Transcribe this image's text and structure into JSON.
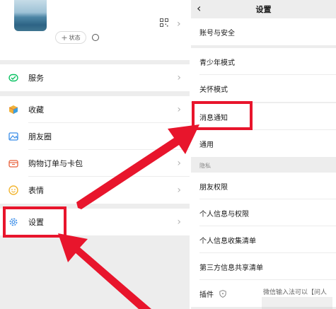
{
  "profile": {
    "status_label": "状态",
    "status_plus": "+"
  },
  "menu": {
    "items": [
      {
        "label": "服务",
        "icon": "service-icon"
      },
      {
        "label": "收藏",
        "icon": "favorites-icon"
      },
      {
        "label": "朋友圈",
        "icon": "moments-icon"
      },
      {
        "label": "购物订单与卡包",
        "icon": "cards-icon"
      },
      {
        "label": "表情",
        "icon": "emoji-icon"
      },
      {
        "label": "设置",
        "icon": "gear-icon"
      }
    ]
  },
  "settings": {
    "title": "设置",
    "back_glyph": "‹",
    "items": [
      {
        "label": "账号与安全"
      },
      {
        "label": "青少年模式"
      },
      {
        "label": "关怀模式"
      },
      {
        "label": "消息通知"
      },
      {
        "label": "通用"
      },
      {
        "label": "朋友权限"
      },
      {
        "label": "个人信息与权限"
      },
      {
        "label": "个人信息收集清单"
      },
      {
        "label": "第三方信息共享清单"
      },
      {
        "label": "插件"
      }
    ],
    "privacy_section": "隐私",
    "overlay_text": "微信输入法可以【问人"
  },
  "colors": {
    "annotation": "#e8152c",
    "wechat_green": "#07c160"
  }
}
